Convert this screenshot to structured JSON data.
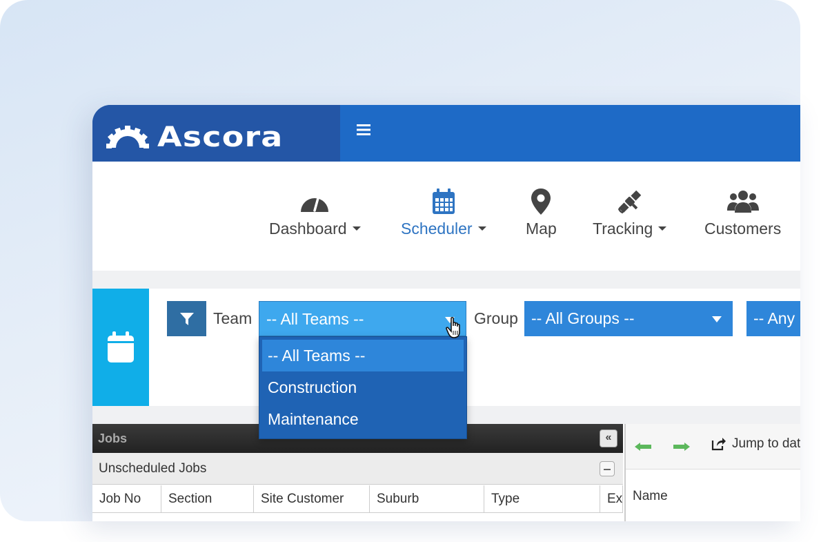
{
  "app": {
    "logo_text": "Ascora",
    "menu_icon": "hamburger-icon"
  },
  "nav": {
    "items": [
      {
        "label": "Dashboard",
        "icon": "speedometer-icon",
        "has_caret": true,
        "active": false
      },
      {
        "label": "Scheduler",
        "icon": "calendar-icon",
        "has_caret": true,
        "active": true
      },
      {
        "label": "Map",
        "icon": "map-pin-icon",
        "has_caret": false,
        "active": false
      },
      {
        "label": "Tracking",
        "icon": "satellite-icon",
        "has_caret": true,
        "active": false
      },
      {
        "label": "Customers",
        "icon": "users-icon",
        "has_caret": false,
        "active": false
      }
    ]
  },
  "filters": {
    "team_label": "Team",
    "team_value": "-- All Teams --",
    "group_label": "Group",
    "group_value": "-- All Groups --",
    "any_value": "-- Any"
  },
  "team_dropdown": {
    "options": [
      "-- All Teams --",
      "Construction",
      "Maintenance"
    ],
    "selected": "-- All Teams --"
  },
  "jobs_panel": {
    "title": "Jobs",
    "section": "Unscheduled Jobs",
    "columns": [
      "Job No",
      "Section",
      "Site Customer",
      "Suburb",
      "Type",
      "Ex"
    ]
  },
  "calendar_panel": {
    "jump_label": "Jump to dat",
    "name_column": "Name"
  },
  "colors": {
    "header_blue": "#1e6ac6",
    "logo_blue": "#2456a6",
    "accent_cyan": "#10aee8",
    "select_blue": "#2e86da",
    "dropdown_blue": "#1f63b4"
  }
}
